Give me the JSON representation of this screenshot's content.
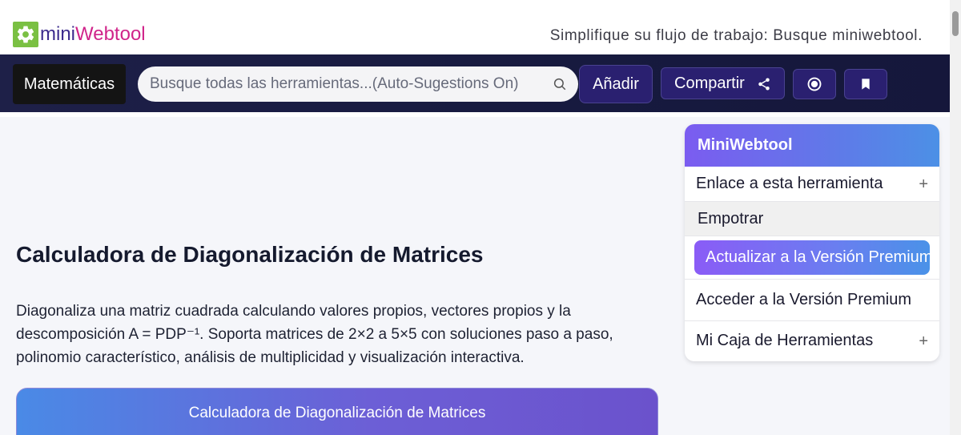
{
  "header": {
    "logo_mini": "mini",
    "logo_web": "Webtool",
    "tagline": "Simplifique su flujo de trabajo: Busque miniwebtool."
  },
  "nav": {
    "category": "Matemáticas",
    "search_placeholder": "Busque todas las herramientas...(Auto-Sugestions On)",
    "add_label": "Añadir",
    "share_label": "Compartir"
  },
  "main": {
    "title": "Calculadora de Diagonalización de Matrices",
    "description": "Diagonaliza una matriz cuadrada calculando valores propios, vectores propios y la descomposición A = PDP⁻¹. Soporta matrices de 2×2 a 5×5 con soluciones paso a paso, polinomio característico, análisis de multiplicidad y visualización interactiva.",
    "card_title": "Calculadora de Diagonalización de Matrices"
  },
  "sidebar": {
    "title": "MiniWebtool",
    "items": [
      {
        "label": "Enlace a esta herramienta"
      },
      {
        "label": "Empotrar"
      },
      {
        "label": "Actualizar a la Versión Premium"
      },
      {
        "label": "Acceder a la Versión Premium"
      },
      {
        "label": "Mi Caja de Herramientas"
      }
    ]
  },
  "colors": {
    "nav_bg": "#1e2048",
    "accent_purple": "#7b5cf0",
    "accent_blue": "#4c90e6",
    "logo_green": "#7ac043",
    "logo_pink": "#d0248a"
  },
  "icons": {
    "logo": "gear-icon",
    "search": "search-icon",
    "share": "share-icon",
    "record": "record-icon",
    "bookmark": "bookmark-icon",
    "expand": "plus-icon"
  }
}
